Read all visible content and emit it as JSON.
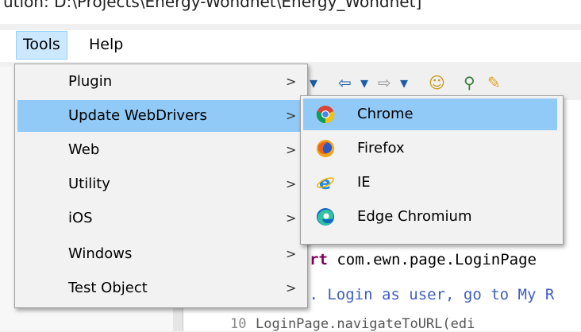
{
  "window": {
    "title_fragment": "ution: D:\\Projects\\Energy-Wondnet\\Energy_Wondnet]"
  },
  "menubar": {
    "items": [
      {
        "label": "Tools",
        "active": true
      },
      {
        "label": "Help",
        "active": false
      }
    ]
  },
  "tools_menu": {
    "items": [
      {
        "label": "Plugin",
        "arrow": ">"
      },
      {
        "label": "Update WebDrivers",
        "arrow": ">",
        "highlighted": true
      },
      {
        "label": "Web",
        "arrow": ">"
      },
      {
        "label": "Utility",
        "arrow": ">"
      },
      {
        "label": "iOS",
        "arrow": ">"
      },
      {
        "label": "Windows",
        "arrow": ">"
      },
      {
        "label": "Test Object",
        "arrow": ">"
      }
    ]
  },
  "webdrivers_submenu": {
    "items": [
      {
        "label": "Chrome",
        "icon": "chrome-icon",
        "highlighted": true
      },
      {
        "label": "Firefox",
        "icon": "firefox-icon"
      },
      {
        "label": "IE",
        "icon": "ie-icon"
      },
      {
        "label": "Edge Chromium",
        "icon": "edge-icon"
      }
    ]
  },
  "editor": {
    "line1_kw": "rt",
    "line1_rest": " com.ewn.page.LoginPage",
    "line2": "1. Login as user, go to My R",
    "line3": "LoginPage.navigateToURL(edi",
    "line_number": "10"
  },
  "colors": {
    "highlight": "#91c9f7",
    "menu_bg": "#f2f2f2",
    "active_menubar": "#cce8ff"
  }
}
